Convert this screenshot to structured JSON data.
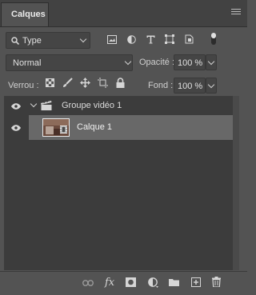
{
  "panel": {
    "tab_label": "Calques"
  },
  "filter": {
    "kind_label": "Type"
  },
  "blend": {
    "mode": "Normal",
    "opacity_label": "Opacité :",
    "opacity_value": "100 %"
  },
  "lock": {
    "label": "Verrou :",
    "fill_label": "Fond :",
    "fill_value": "100 %"
  },
  "layers": [
    {
      "name": "Groupe vidéo 1",
      "type": "video-group"
    },
    {
      "name": "Calque 1",
      "type": "layer"
    }
  ],
  "footer": {
    "fx_label": "fx"
  }
}
